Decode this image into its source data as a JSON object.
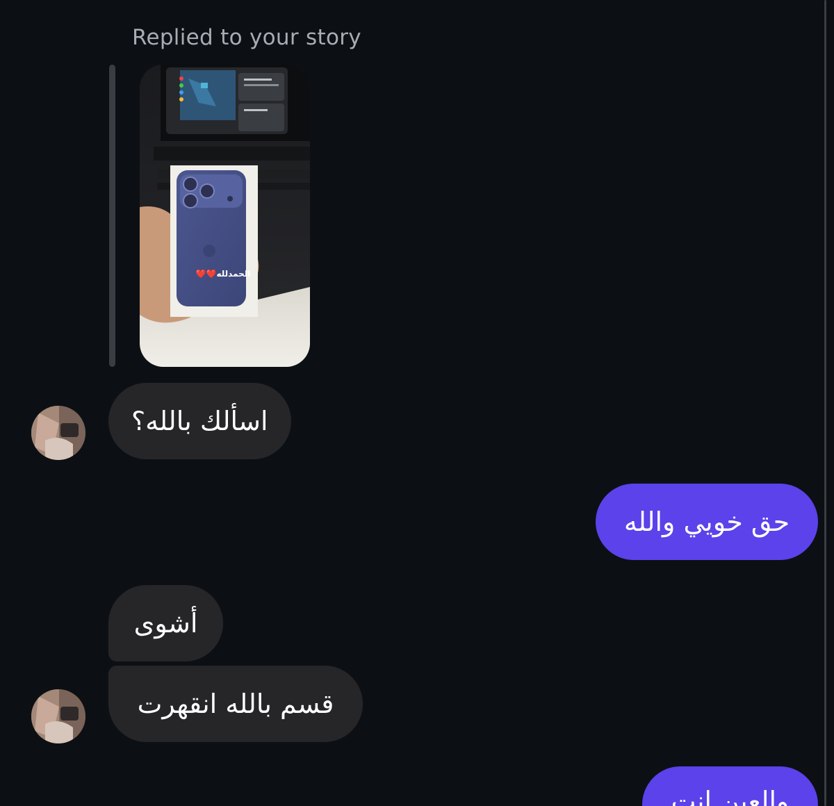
{
  "thread": {
    "reply_caption": "Replied to your story",
    "story": {
      "sticker_text": "الحمدلله❤️❤️"
    },
    "messages": [
      {
        "side": "incoming",
        "text": "اسألك بالله؟",
        "avatar": "contact-avatar"
      },
      {
        "side": "outgoing",
        "text": "حق خويي والله"
      },
      {
        "side": "incoming",
        "text": "أشوى"
      },
      {
        "side": "incoming",
        "text": "قسم بالله انقهرت",
        "avatar": "contact-avatar"
      },
      {
        "side": "outgoing",
        "text": "والعين انت"
      }
    ]
  },
  "colors": {
    "background": "#0c1014",
    "incoming_bubble": "#262629",
    "outgoing_bubble": "#5b42ea",
    "caption": "#a8adb4"
  }
}
